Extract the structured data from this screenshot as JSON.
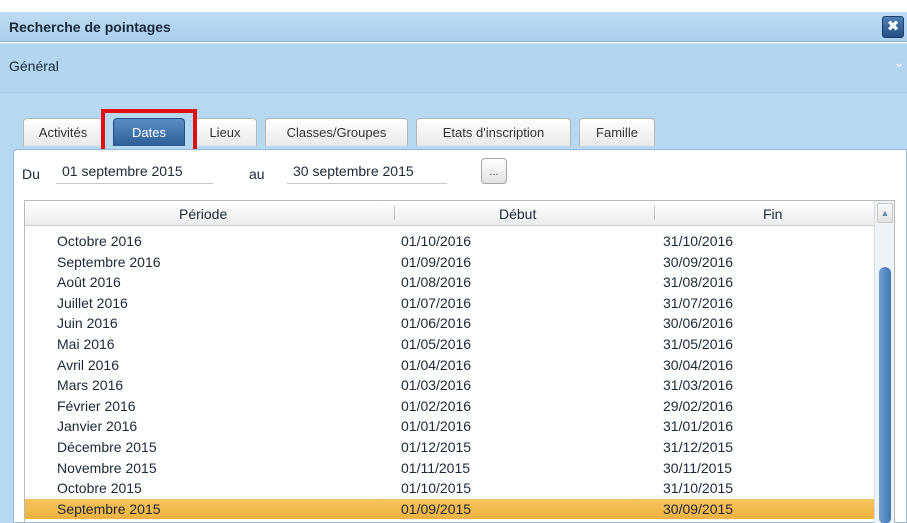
{
  "window": {
    "title": "Recherche de pointages",
    "close_icon_glyph": "✖"
  },
  "section": {
    "label": "Général",
    "chevron_glyph": "⌄"
  },
  "tabs": [
    {
      "label": "Activités",
      "active": false
    },
    {
      "label": "Dates",
      "active": true
    },
    {
      "label": "Lieux",
      "active": false
    },
    {
      "label": "Classes/Groupes",
      "active": false
    },
    {
      "label": "Etats d'inscription",
      "active": false
    },
    {
      "label": "Famille",
      "active": false
    }
  ],
  "date_range": {
    "from_label": "Du",
    "from_value": "01 septembre 2015",
    "to_label": "au",
    "to_value": "30 septembre 2015",
    "picker_button_label": "..."
  },
  "grid": {
    "columns": [
      "Période",
      "Début",
      "Fin"
    ],
    "rows": [
      {
        "periode": "Octobre 2016",
        "debut": "01/10/2016",
        "fin": "31/10/2016",
        "selected": false
      },
      {
        "periode": "Septembre 2016",
        "debut": "01/09/2016",
        "fin": "30/09/2016",
        "selected": false
      },
      {
        "periode": "Août 2016",
        "debut": "01/08/2016",
        "fin": "31/08/2016",
        "selected": false
      },
      {
        "periode": "Juillet 2016",
        "debut": "01/07/2016",
        "fin": "31/07/2016",
        "selected": false
      },
      {
        "periode": "Juin 2016",
        "debut": "01/06/2016",
        "fin": "30/06/2016",
        "selected": false
      },
      {
        "periode": "Mai 2016",
        "debut": "01/05/2016",
        "fin": "31/05/2016",
        "selected": false
      },
      {
        "periode": "Avril 2016",
        "debut": "01/04/2016",
        "fin": "30/04/2016",
        "selected": false
      },
      {
        "periode": "Mars 2016",
        "debut": "01/03/2016",
        "fin": "31/03/2016",
        "selected": false
      },
      {
        "periode": "Février 2016",
        "debut": "01/02/2016",
        "fin": "29/02/2016",
        "selected": false
      },
      {
        "periode": "Janvier 2016",
        "debut": "01/01/2016",
        "fin": "31/01/2016",
        "selected": false
      },
      {
        "periode": "Décembre 2015",
        "debut": "01/12/2015",
        "fin": "31/12/2015",
        "selected": false
      },
      {
        "periode": "Novembre 2015",
        "debut": "01/11/2015",
        "fin": "30/11/2015",
        "selected": false
      },
      {
        "periode": "Octobre 2015",
        "debut": "01/10/2015",
        "fin": "31/10/2015",
        "selected": false
      },
      {
        "periode": "Septembre 2015",
        "debut": "01/09/2015",
        "fin": "30/09/2015",
        "selected": true
      }
    ],
    "scroll_up_glyph": "▲"
  },
  "colors": {
    "header_blue": "#b2d5f0",
    "active_tab": "#2c5e97",
    "selected_row": "#f3b94a",
    "highlight_box": "#e01010"
  }
}
